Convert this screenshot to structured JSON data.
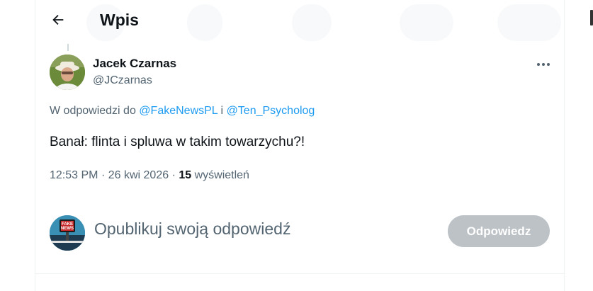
{
  "header": {
    "title": "Wpis",
    "back_icon": "arrow-left-icon"
  },
  "tweet": {
    "author_name": "Jacek Czarnas",
    "author_handle": "@JCzarnas",
    "avatar_icon": "user-avatar",
    "more_icon": "more-dots-icon",
    "reply_prefix": "W odpowiedzi do",
    "mention_1": "@FakeNewsPL",
    "reply_join": "i",
    "mention_2": "@Ten_Psycholog",
    "text": "Banał: flinta i spluwa w takim towarzychu?!",
    "time": "12:53 PM",
    "separator": "·",
    "date": "26 kwi 2026",
    "views_count": "15",
    "views_label": "wyświetleń"
  },
  "composer": {
    "avatar_badge": "FAKE NEWS",
    "placeholder": "Opublikuj swoją odpowiedź",
    "button_label": "Odpowiedz"
  },
  "colors": {
    "accent": "#1d9bf0",
    "text_primary": "#0f1419",
    "text_secondary": "#536471",
    "button_disabled": "#bcc2c6"
  }
}
